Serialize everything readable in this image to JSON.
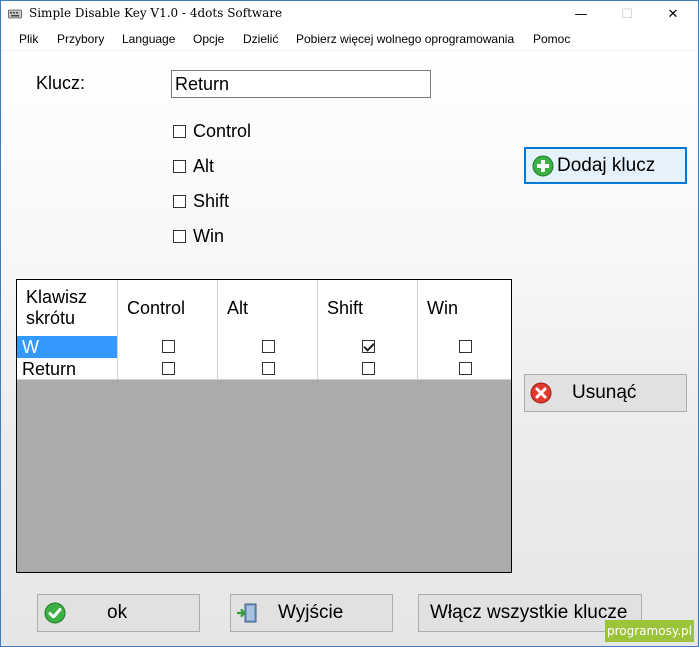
{
  "window": {
    "title": "Simple Disable Key V1.0 - 4dots Software",
    "controls": {
      "minimize": "—",
      "maximize": "☐",
      "close": "✕"
    }
  },
  "menu": {
    "items": [
      {
        "label": "Plik"
      },
      {
        "label": "Przybory"
      },
      {
        "label": "Language"
      },
      {
        "label": "Opcje"
      },
      {
        "label": "Dzielić"
      },
      {
        "label": "Pobierz więcej wolnego oprogramowania"
      },
      {
        "label": "Pomoc"
      }
    ]
  },
  "form": {
    "key_label": "Klucz:",
    "key_value": "Return",
    "modifiers": [
      {
        "label": "Control",
        "checked": false
      },
      {
        "label": "Alt",
        "checked": false
      },
      {
        "label": "Shift",
        "checked": false
      },
      {
        "label": "Win",
        "checked": false
      }
    ]
  },
  "buttons": {
    "add": "Dodaj klucz",
    "remove": "Usunąć",
    "ok": "ok",
    "exit": "Wyjście",
    "enable_all": "Włącz wszystkie klucze"
  },
  "grid": {
    "columns": [
      "Klawisz\nskrótu",
      "Control",
      "Alt",
      "Shift",
      "Win"
    ],
    "rows": [
      {
        "key": "W",
        "control": false,
        "alt": false,
        "shift": true,
        "win": false,
        "selected": true
      },
      {
        "key": "Return",
        "control": false,
        "alt": false,
        "shift": false,
        "win": false,
        "selected": false
      }
    ]
  },
  "watermark": "programosy.pl",
  "colors": {
    "selection": "#3399ff",
    "accent_border": "#0078d7",
    "add_icon": "#3cb043",
    "remove_icon": "#e03a2f",
    "watermark_bg": "#9cc43a"
  }
}
